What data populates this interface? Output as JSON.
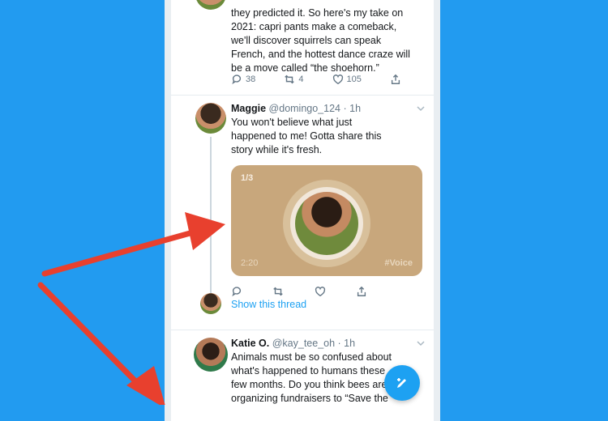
{
  "tweet_top": {
    "text_lines": [
      "they predicted it. So here's my take on",
      "2021: capri pants make a comeback,",
      "we'll discover squirrels can speak",
      "French, and the hottest dance craze will",
      "be a move called “the shoehorn.”"
    ],
    "replies": "38",
    "retweets": "4",
    "likes": "105"
  },
  "tweet_maggie": {
    "name": "Maggie",
    "handle": "@domingo_124",
    "time": "· 1h",
    "text_lines": [
      "You won't believe what just",
      "happened to me! Gotta share this",
      "story while it's fresh."
    ],
    "media": {
      "counter": "1/3",
      "duration": "2:20",
      "tag": "#Voice"
    },
    "show_thread": "Show this thread"
  },
  "tweet_katie": {
    "name": "Katie O.",
    "handle": "@kay_tee_oh",
    "time": "· 1h",
    "text_lines": [
      "Animals must be so confused about",
      "what's happened to humans these",
      "few months. Do you think bees are",
      "organizing fundraisers to “Save the"
    ]
  },
  "colors": {
    "background": "#229bf0",
    "accent": "#1da1f2",
    "media_bg": "#c8a77c",
    "arrow": "#e8402e"
  },
  "icons": [
    "reply-icon",
    "retweet-icon",
    "like-icon",
    "share-icon",
    "chevron-down-icon",
    "compose-icon"
  ]
}
